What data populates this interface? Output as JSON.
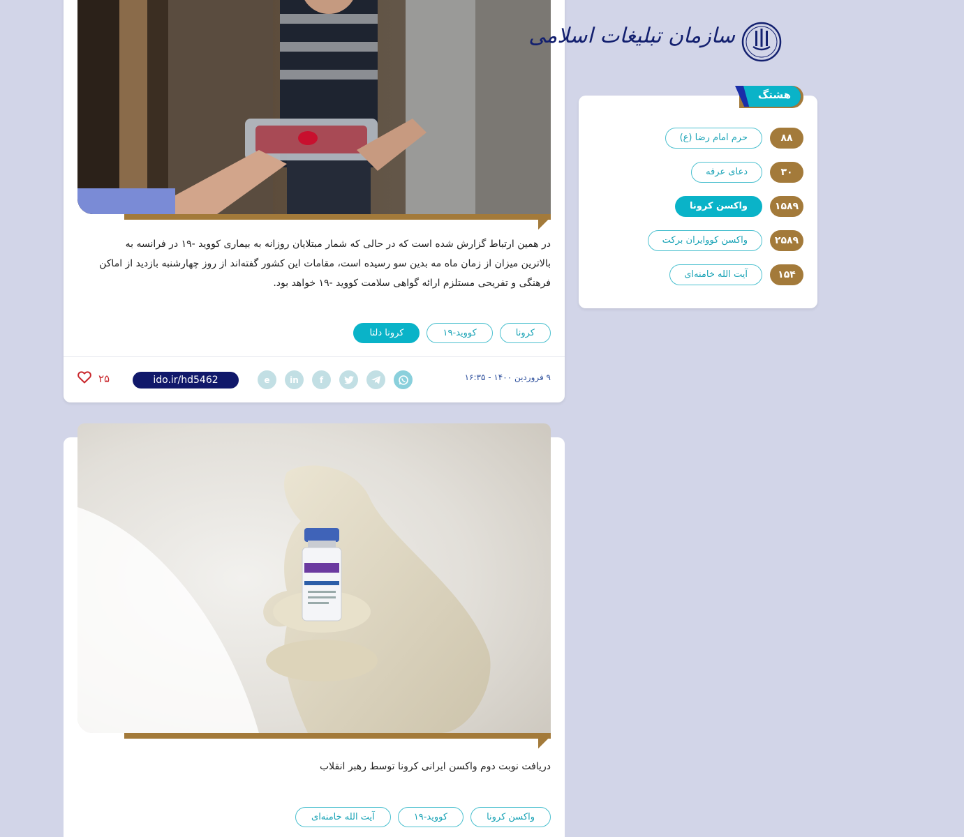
{
  "logo": {
    "name": "سازمان تبلیغات اسلامی"
  },
  "hashtags": {
    "title": "هشتگ",
    "items": [
      {
        "label": "حرم امام رضا (ع)",
        "count": "۸۸",
        "active": false
      },
      {
        "label": "دعای عرفه",
        "count": "۳۰",
        "active": false
      },
      {
        "label": "واکسن کرونا",
        "count": "۱۵۸۹",
        "active": true
      },
      {
        "label": "واکسن کووایران برکت",
        "count": "۲۵۸۹",
        "active": false
      },
      {
        "label": "آیت الله خامنه‌ای",
        "count": "۱۵۴",
        "active": false
      }
    ]
  },
  "posts": [
    {
      "summary": "در همین ارتباط گزارش شده است که در حالی که شمار مبتلایان روزانه به بیماری کووید -۱۹ در فرانسه به بالاترین میزان از زمان ماه مه بدین سو رسیده است، مقامات این کشور گفته‌اند از روز چهارشنبه بازدید از اماکن فرهنگی و تفریحی مستلزم ارائه گواهی سلامت کووید -۱۹ خواهد بود.",
      "tags": [
        {
          "label": "کرونا",
          "active": false
        },
        {
          "label": "کووید-۱۹",
          "active": false
        },
        {
          "label": "کرونا دلتا",
          "active": true
        }
      ],
      "date": "۹ فروردین ۱۴۰۰ - ۱۶:۳۵",
      "short_link": "ido.ir/hd5462",
      "likes": "۲۵",
      "share_icons": [
        "whatsapp-icon",
        "telegram-icon",
        "twitter-icon",
        "facebook-icon",
        "linkedin-icon",
        "eitaa-icon"
      ]
    },
    {
      "summary": "دریافت نوبت دوم واکسن ایرانی کرونا توسط رهبر انقلاب",
      "tags": [
        {
          "label": "واکسن کرونا",
          "active": false
        },
        {
          "label": "کووید-۱۹",
          "active": false
        },
        {
          "label": "آیت الله خامنه‌ای",
          "active": false
        }
      ]
    }
  ],
  "colors": {
    "background": "#d2d5e8",
    "accent_cyan": "#0ab3c8",
    "accent_gold": "#a37a3a",
    "navy": "#10186a",
    "like_red": "#c9282d"
  }
}
